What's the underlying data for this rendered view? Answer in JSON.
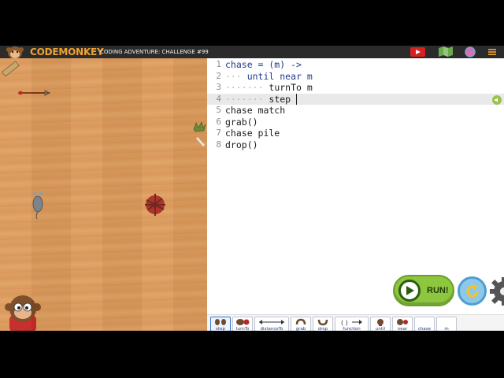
{
  "header": {
    "logo_text": "CODEMONKEY",
    "challenge_title": "CODING ADVENTURE: CHALLENGE #99",
    "icons": [
      "youtube-icon",
      "map-icon",
      "globe-icon",
      "menu-icon"
    ]
  },
  "colors": {
    "brand_orange": "#f0a22e",
    "topbar": "#2b2b2b",
    "keyword_blue": "#1f3a8a",
    "run_green": "#8dc63f",
    "reset_blue": "#8ec8e8"
  },
  "editor": {
    "lines": [
      {
        "num": "1",
        "text": "chase = (m) ->"
      },
      {
        "num": "2",
        "text": "until near m"
      },
      {
        "num": "3",
        "text": "turnTo m"
      },
      {
        "num": "4",
        "text": "step "
      },
      {
        "num": "5",
        "text": "chase match"
      },
      {
        "num": "6",
        "text": "grab()"
      },
      {
        "num": "7",
        "text": "chase pile"
      },
      {
        "num": "8",
        "text": "drop()"
      }
    ]
  },
  "controls": {
    "run_label": "RUN!"
  },
  "palette": {
    "blocks": [
      "step",
      "turnTo",
      "distanceTo",
      "grab",
      "drop",
      "function",
      "until",
      "near",
      "chase",
      "m"
    ]
  }
}
